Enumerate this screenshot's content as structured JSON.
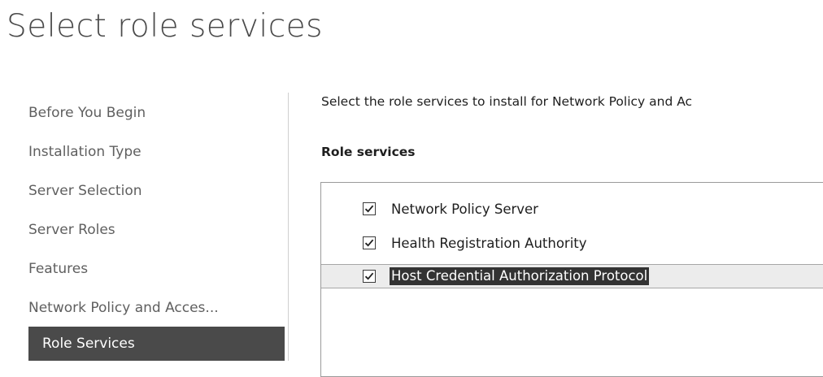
{
  "header": {
    "title": "Select role services"
  },
  "nav": {
    "items": [
      {
        "label": "Before You Begin"
      },
      {
        "label": "Installation Type"
      },
      {
        "label": "Server Selection"
      },
      {
        "label": "Server Roles"
      },
      {
        "label": "Features"
      },
      {
        "label": "Network Policy and Acces..."
      },
      {
        "label": "Role Services",
        "current": true
      }
    ]
  },
  "content": {
    "intro": "Select the role services to install for Network Policy and Ac",
    "section_heading": "Role services",
    "services": [
      {
        "label": "Network Policy Server",
        "checked": true
      },
      {
        "label": "Health Registration Authority",
        "checked": true
      },
      {
        "label": "Host Credential Authorization Protocol",
        "checked": true,
        "selected": true
      }
    ]
  },
  "colors": {
    "nav_current_bg": "#4a4a4a",
    "selection_highlight": "#333333",
    "selected_row_bg": "#ececec"
  }
}
